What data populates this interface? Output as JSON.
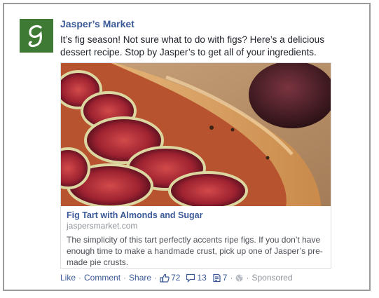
{
  "post": {
    "page_name": "Jasper’s Market",
    "avatar_letter": "g",
    "text": "It’s fig season! Not sure what to do with figs? Here’s a delicious dessert recipe. Stop by Jasper’s to get all of your ingredients."
  },
  "link_card": {
    "title": "Fig Tart with Almonds and Sugar",
    "domain": "jaspersmarket.com",
    "description": "The simplicity of this tart perfectly accents ripe figs. If you don’t have enough time to make a handmade crust, pick up one of Jasper’s pre-made pie crusts."
  },
  "actions": {
    "like": "Like",
    "comment": "Comment",
    "share": "Share",
    "separator": "·",
    "like_count": "72",
    "comment_count": "13",
    "share_count": "7",
    "sponsored": "Sponsored"
  },
  "colors": {
    "link_blue": "#3b5998",
    "avatar_green": "#3f7a35",
    "meta_gray": "#90949c"
  },
  "icons": [
    "thumbs-up-icon",
    "comment-bubble-icon",
    "share-count-icon",
    "globe-icon"
  ]
}
